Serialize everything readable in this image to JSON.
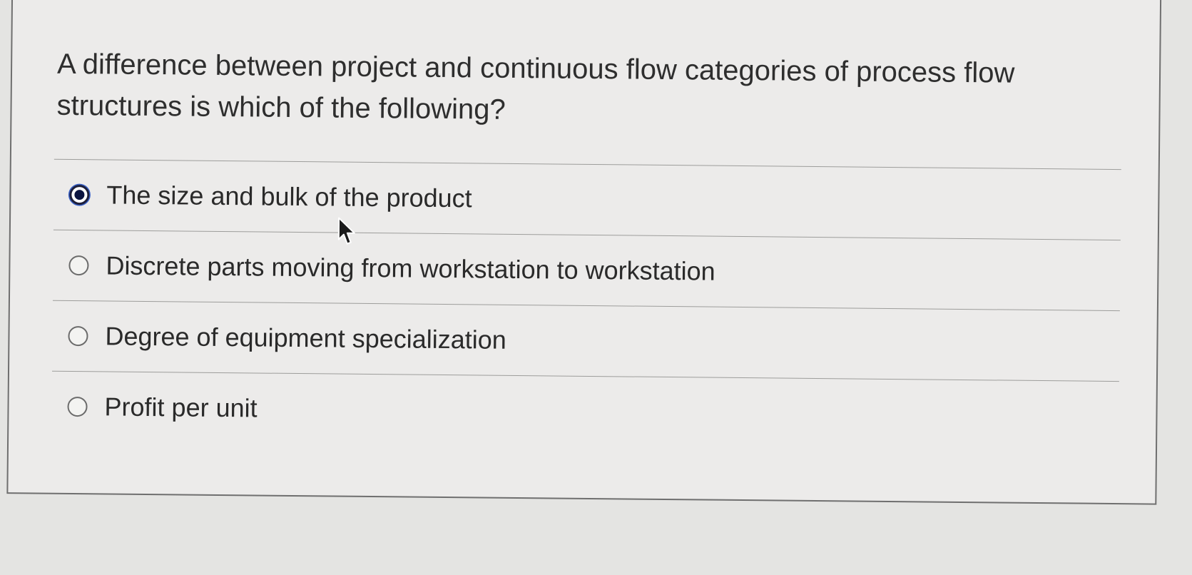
{
  "question": {
    "text": "A difference between project and continuous flow categories of process flow structures is which of the following?"
  },
  "options": [
    {
      "label": "The size and bulk of the product",
      "selected": true
    },
    {
      "label": "Discrete parts moving from workstation to workstation",
      "selected": false
    },
    {
      "label": "Degree of equipment specialization",
      "selected": false
    },
    {
      "label": "Profit per unit",
      "selected": false
    }
  ],
  "colors": {
    "background": "#e4e4e2",
    "card": "#ecebea",
    "text": "#2b2b2b",
    "selected_radio": "#0b1440",
    "focus_ring": "#3a62c8"
  },
  "icons": {
    "cursor": "mouse-pointer-icon"
  }
}
